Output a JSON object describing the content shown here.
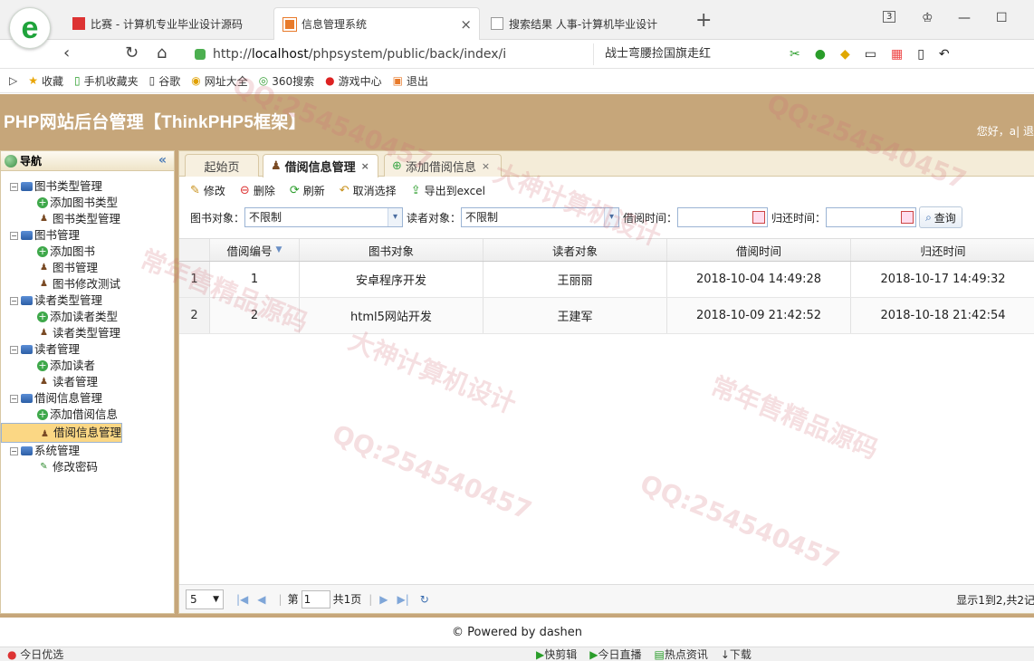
{
  "browser": {
    "tabs": [
      {
        "title": "比赛 - 计算机专业毕业设计源码"
      },
      {
        "title": "信息管理系统"
      },
      {
        "title": "搜索结果 人事-计算机毕业设计"
      }
    ],
    "tab_count": "3",
    "url_scheme": "http://",
    "url_host": "localhost",
    "url_path": "/phpsystem/public/back/index/i",
    "search_text": "战士弯腰捡国旗走红",
    "bookmarks": [
      "收藏",
      "手机收藏夹",
      "谷歌",
      "网址大全",
      "360搜索",
      "游戏中心",
      "退出"
    ]
  },
  "app": {
    "title": "PHP网站后台管理【ThinkPHP5框架】",
    "greeting": "您好，a| 退"
  },
  "sidebar": {
    "header": "导航",
    "groups": [
      {
        "label": "图书类型管理",
        "items": [
          "添加图书类型",
          "图书类型管理"
        ]
      },
      {
        "label": "图书管理",
        "items": [
          "添加图书",
          "图书管理",
          "图书修改测试"
        ]
      },
      {
        "label": "读者类型管理",
        "items": [
          "添加读者类型",
          "读者类型管理"
        ]
      },
      {
        "label": "读者管理",
        "items": [
          "添加读者",
          "读者管理"
        ]
      },
      {
        "label": "借阅信息管理",
        "items": [
          "添加借阅信息",
          "借阅信息管理"
        ]
      },
      {
        "label": "系统管理",
        "items": [
          "修改密码"
        ]
      }
    ],
    "selected": "借阅信息管理"
  },
  "page_tabs": [
    {
      "label": "起始页"
    },
    {
      "label": "借阅信息管理",
      "close": "×"
    },
    {
      "label": "添加借阅信息",
      "close": "×"
    }
  ],
  "toolbar": {
    "edit": "修改",
    "delete": "删除",
    "refresh": "刷新",
    "unselect": "取消选择",
    "export": "导出到excel"
  },
  "filters": {
    "book_label": "图书对象：",
    "book_value": "不限制",
    "reader_label": "读者对象：",
    "reader_value": "不限制",
    "borrow_label": "借阅时间：",
    "return_label": "归还时间：",
    "query": "查询"
  },
  "grid": {
    "columns": [
      "借阅编号",
      "图书对象",
      "读者对象",
      "借阅时间",
      "归还时间"
    ],
    "rows": [
      {
        "num": "1",
        "id": "1",
        "book": "安卓程序开发",
        "reader": "王丽丽",
        "borrow": "2018-10-04 14:49:28",
        "return": "2018-10-17 14:49:32"
      },
      {
        "num": "2",
        "id": "2",
        "book": "html5网站开发",
        "reader": "王建军",
        "borrow": "2018-10-09 21:42:52",
        "return": "2018-10-18 21:42:54"
      }
    ]
  },
  "pager": {
    "page_size": "5",
    "page_prefix": "第",
    "page": "1",
    "page_suffix": "共1页",
    "info": "显示1到2,共2记"
  },
  "footer": "© Powered by dashen",
  "status": {
    "left": "今日优选",
    "right": [
      "快剪辑",
      "今日直播",
      "热点资讯",
      "下载"
    ]
  },
  "watermarks": [
    "QQ:254540457",
    "大神计算机设计",
    "常年售精品源码"
  ],
  "colors": {
    "banner": "#c6a67a",
    "selected": "#fbd784"
  }
}
